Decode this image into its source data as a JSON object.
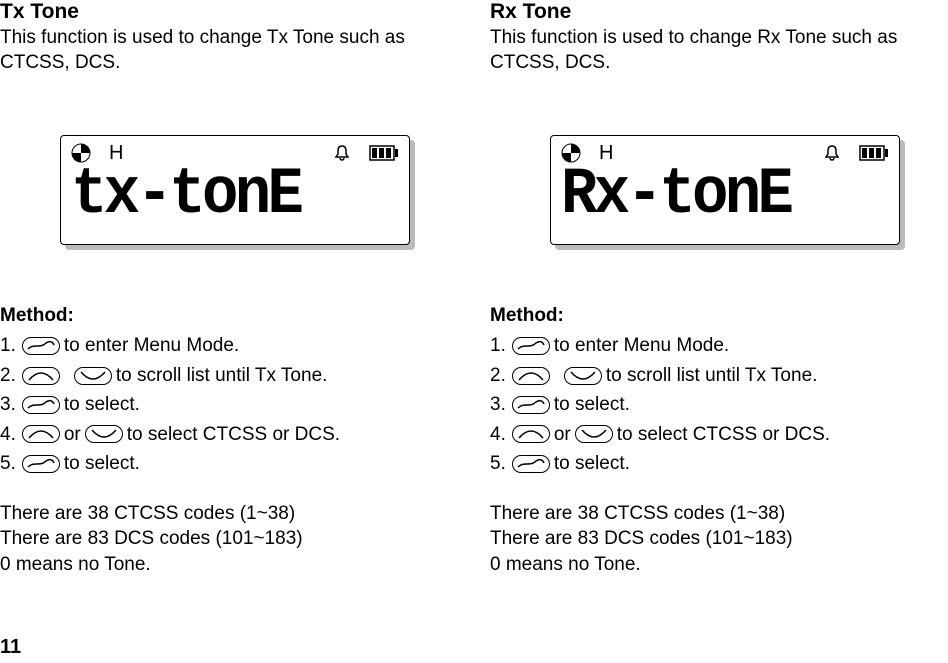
{
  "page_number": "11",
  "left": {
    "title": "Tx Tone",
    "desc": "This function is used to change Tx Tone such as CTCSS, DCS.",
    "lcd_indicator_letter": "H",
    "lcd_text": "tx-tonE",
    "method_heading": "Method:",
    "steps": {
      "1": {
        "num": "1.",
        "after": " to enter Menu Mode."
      },
      "2": {
        "num": "2.",
        "after": "   to scroll list until Tx Tone."
      },
      "3": {
        "num": "3.",
        "after": " to select."
      },
      "4": {
        "num": "4.",
        "mid": " or ",
        "after": " to select CTCSS or DCS."
      },
      "5": {
        "num": "5.",
        "after": " to select."
      }
    },
    "notes": {
      "a": "There are 38 CTCSS codes (1~38)",
      "b": "There are 83 DCS codes (101~183)",
      "c": "0 means no Tone."
    }
  },
  "right": {
    "title": "Rx Tone",
    "desc": "This function is used to change Rx Tone such as CTCSS, DCS.",
    "lcd_indicator_letter": "H",
    "lcd_text": "Rx-tonE",
    "method_heading": "Method:",
    "steps": {
      "1": {
        "num": "1.",
        "after": " to enter Menu Mode."
      },
      "2": {
        "num": "2.",
        "after": "   to scroll list until Tx Tone."
      },
      "3": {
        "num": "3.",
        "after": " to select."
      },
      "4": {
        "num": "4.",
        "mid": " or ",
        "after": " to select CTCSS or DCS."
      },
      "5": {
        "num": "5.",
        "after": " to select."
      }
    },
    "notes": {
      "a": "There are 38 CTCSS codes (1~38)",
      "b": "There are 83 DCS codes (101~183)",
      "c": "0 means no Tone."
    }
  }
}
